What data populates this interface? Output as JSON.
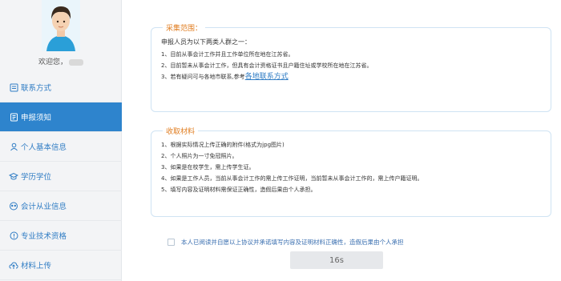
{
  "profile": {
    "welcome": "欢迎您，"
  },
  "nav": [
    {
      "label": "联系方式",
      "icon": "contact-icon",
      "active": false
    },
    {
      "label": "申报须知",
      "icon": "notice-icon",
      "active": true
    },
    {
      "label": "个人基本信息",
      "icon": "person-icon",
      "active": false
    },
    {
      "label": "学历学位",
      "icon": "graduation-cap-icon",
      "active": false
    },
    {
      "label": "会计从业信息",
      "icon": "group-icon",
      "active": false
    },
    {
      "label": "专业技术资格",
      "icon": "certificate-icon",
      "active": false
    },
    {
      "label": "材料上传",
      "icon": "cloud-upload-icon",
      "active": false
    }
  ],
  "scope": {
    "title": "采集范围：",
    "intro": "申报人员为以下两类人群之一：",
    "items": [
      "1、目前从事会计工作并且工作单位所在地在江苏省。",
      "2、目前暂未从事会计工作，但具有会计资格证书且户籍住址或学校所在地在江苏省。",
      "3、若有疑问可与各地市联系,参考"
    ],
    "link": "各地联系方式"
  },
  "materials": {
    "title": "收取材料",
    "items": [
      "1、根据实际情况上传正确的附件(格式为jpg图片)",
      "2、个人照片为一寸免冠照片。",
      "3、如果是在校学生，需上传学生证。",
      "4、如果是工作人员，当前从事会计工作的需上传工作证明，当前暂未从事会计工作的，需上传户籍证明。",
      "5、填写内容及证明材料需保证正确性，造假后果由个人承担。"
    ]
  },
  "agreement": {
    "text": "本人已阅读并自愿以上协议并承诺填写内容及证明材料正确性，造假后果由个人承担",
    "checked": false
  },
  "timer_button": {
    "label": "16s"
  },
  "colors": {
    "accent": "#2e84cd",
    "title_orange": "#e07d20",
    "link": "#2f7cc4"
  }
}
